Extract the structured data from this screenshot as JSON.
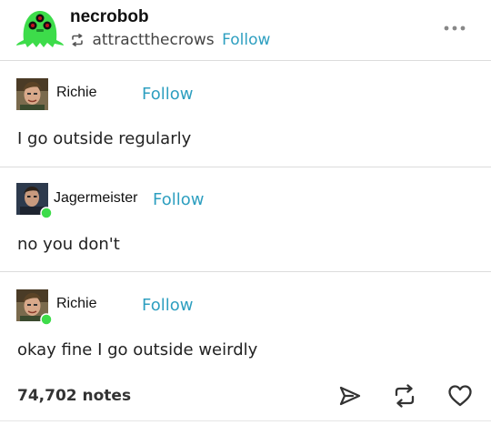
{
  "header": {
    "blog_name": "necrobob",
    "reblogged_from": "attractthecrows",
    "follow_label": "Follow",
    "more_label": "•••"
  },
  "thread": [
    {
      "username": "Richie",
      "follow_label": "Follow",
      "text": "I go outside regularly"
    },
    {
      "username": "Jagermeister",
      "follow_label": "Follow",
      "text": "no you don't"
    },
    {
      "username": "Richie",
      "follow_label": "Follow",
      "text": "okay fine I go outside weirdly"
    }
  ],
  "footer": {
    "notes": "74,702 notes"
  },
  "icons": {
    "more": "more-icon",
    "reblog_small": "reblog-icon",
    "share": "share-icon",
    "reblog": "reblog-icon",
    "like": "heart-icon"
  },
  "colors": {
    "follow": "#2e9fc0",
    "avatar_green": "#3ddc4a",
    "text": "#222222",
    "divider": "#dcdcdc"
  }
}
